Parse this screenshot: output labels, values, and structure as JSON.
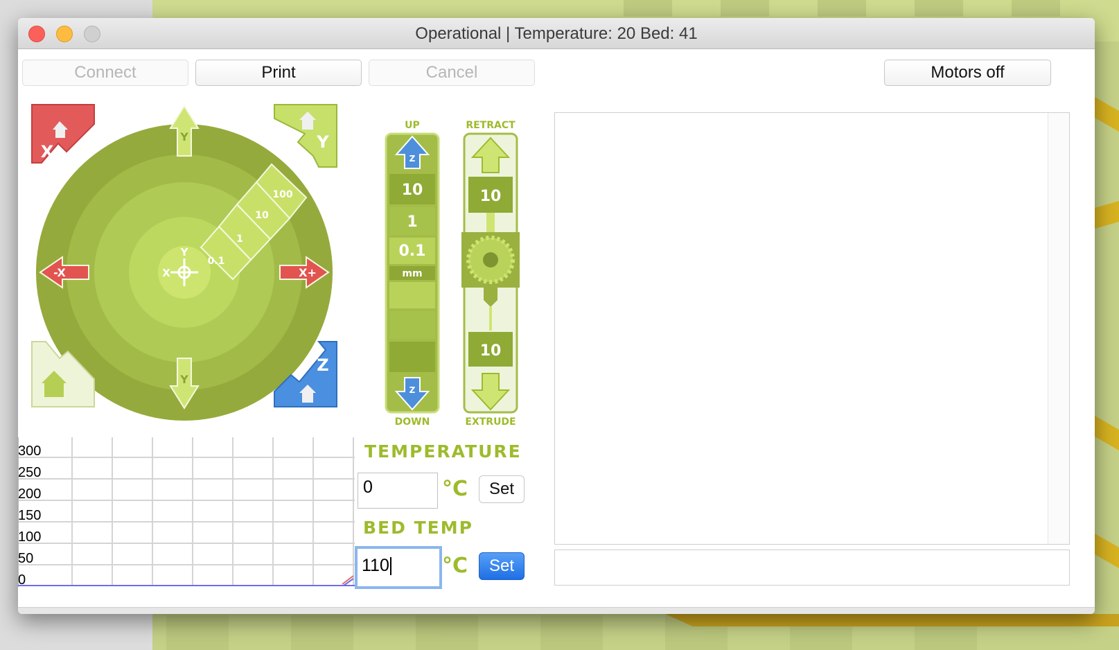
{
  "window": {
    "title": "Operational | Temperature: 20 Bed: 41"
  },
  "toolbar": {
    "connect_label": "Connect",
    "print_label": "Print",
    "cancel_label": "Cancel",
    "motors_off_label": "Motors off"
  },
  "xy_pad": {
    "home_x_label": "X",
    "home_y_label": "Y",
    "home_z_label": "Z",
    "y_plus_label": "Y",
    "y_minus_label": "Y",
    "x_minus_label": "-X",
    "x_plus_label": "X+",
    "center_x_label": "X",
    "center_y_label": "Y",
    "steps": [
      "100",
      "10",
      "1",
      "0.1"
    ]
  },
  "z_column": {
    "up_label": "UP",
    "down_label": "DOWN",
    "z_label": "Z",
    "steps": [
      "10",
      "1",
      "0.1"
    ],
    "unit_label": "mm"
  },
  "extruder": {
    "retract_label": "RETRACT",
    "extrude_label": "EXTRUDE",
    "retract_amount": "10",
    "extrude_amount": "10"
  },
  "temperature": {
    "heading": "TEMPERATURE",
    "value": "0",
    "unit": "°C",
    "set_label": "Set"
  },
  "bed": {
    "heading": "BED TEMP",
    "value": "110",
    "unit": "°C",
    "set_label": "Set"
  },
  "graph": {
    "y_ticks": [
      "300",
      "250",
      "200",
      "150",
      "100",
      "50",
      "0"
    ]
  },
  "colors": {
    "outer_ring": "#96aa3d",
    "ring2": "#a3bd4a",
    "ring3": "#b0cc56",
    "inner": "#bfda61",
    "home_red": "#e35a5a",
    "home_blue": "#4a8fe0",
    "arrow_red": "#e2544f",
    "z_blue": "#4d8fdb",
    "accent_text": "#9dbb2c",
    "set_blue": "#2a78ea"
  }
}
